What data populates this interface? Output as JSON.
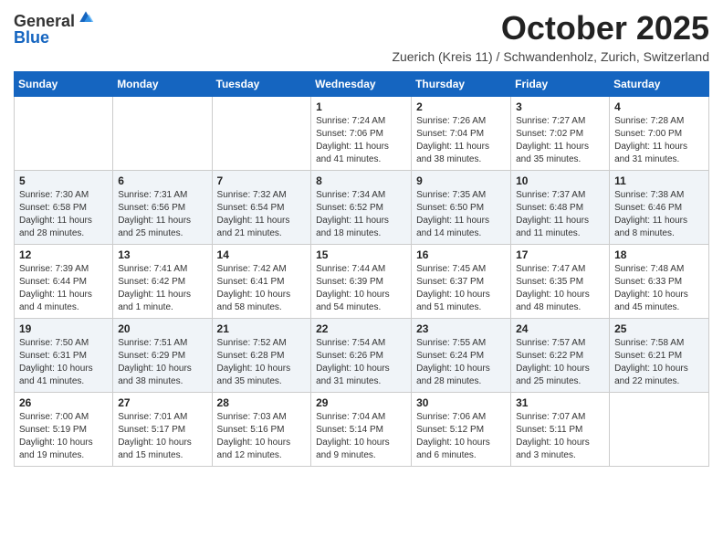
{
  "logo": {
    "general": "General",
    "blue": "Blue"
  },
  "title": "October 2025",
  "subtitle": "Zuerich (Kreis 11) / Schwandenholz, Zurich, Switzerland",
  "days_of_week": [
    "Sunday",
    "Monday",
    "Tuesday",
    "Wednesday",
    "Thursday",
    "Friday",
    "Saturday"
  ],
  "weeks": [
    [
      {
        "day": "",
        "info": ""
      },
      {
        "day": "",
        "info": ""
      },
      {
        "day": "",
        "info": ""
      },
      {
        "day": "1",
        "info": "Sunrise: 7:24 AM\nSunset: 7:06 PM\nDaylight: 11 hours and 41 minutes."
      },
      {
        "day": "2",
        "info": "Sunrise: 7:26 AM\nSunset: 7:04 PM\nDaylight: 11 hours and 38 minutes."
      },
      {
        "day": "3",
        "info": "Sunrise: 7:27 AM\nSunset: 7:02 PM\nDaylight: 11 hours and 35 minutes."
      },
      {
        "day": "4",
        "info": "Sunrise: 7:28 AM\nSunset: 7:00 PM\nDaylight: 11 hours and 31 minutes."
      }
    ],
    [
      {
        "day": "5",
        "info": "Sunrise: 7:30 AM\nSunset: 6:58 PM\nDaylight: 11 hours and 28 minutes."
      },
      {
        "day": "6",
        "info": "Sunrise: 7:31 AM\nSunset: 6:56 PM\nDaylight: 11 hours and 25 minutes."
      },
      {
        "day": "7",
        "info": "Sunrise: 7:32 AM\nSunset: 6:54 PM\nDaylight: 11 hours and 21 minutes."
      },
      {
        "day": "8",
        "info": "Sunrise: 7:34 AM\nSunset: 6:52 PM\nDaylight: 11 hours and 18 minutes."
      },
      {
        "day": "9",
        "info": "Sunrise: 7:35 AM\nSunset: 6:50 PM\nDaylight: 11 hours and 14 minutes."
      },
      {
        "day": "10",
        "info": "Sunrise: 7:37 AM\nSunset: 6:48 PM\nDaylight: 11 hours and 11 minutes."
      },
      {
        "day": "11",
        "info": "Sunrise: 7:38 AM\nSunset: 6:46 PM\nDaylight: 11 hours and 8 minutes."
      }
    ],
    [
      {
        "day": "12",
        "info": "Sunrise: 7:39 AM\nSunset: 6:44 PM\nDaylight: 11 hours and 4 minutes."
      },
      {
        "day": "13",
        "info": "Sunrise: 7:41 AM\nSunset: 6:42 PM\nDaylight: 11 hours and 1 minute."
      },
      {
        "day": "14",
        "info": "Sunrise: 7:42 AM\nSunset: 6:41 PM\nDaylight: 10 hours and 58 minutes."
      },
      {
        "day": "15",
        "info": "Sunrise: 7:44 AM\nSunset: 6:39 PM\nDaylight: 10 hours and 54 minutes."
      },
      {
        "day": "16",
        "info": "Sunrise: 7:45 AM\nSunset: 6:37 PM\nDaylight: 10 hours and 51 minutes."
      },
      {
        "day": "17",
        "info": "Sunrise: 7:47 AM\nSunset: 6:35 PM\nDaylight: 10 hours and 48 minutes."
      },
      {
        "day": "18",
        "info": "Sunrise: 7:48 AM\nSunset: 6:33 PM\nDaylight: 10 hours and 45 minutes."
      }
    ],
    [
      {
        "day": "19",
        "info": "Sunrise: 7:50 AM\nSunset: 6:31 PM\nDaylight: 10 hours and 41 minutes."
      },
      {
        "day": "20",
        "info": "Sunrise: 7:51 AM\nSunset: 6:29 PM\nDaylight: 10 hours and 38 minutes."
      },
      {
        "day": "21",
        "info": "Sunrise: 7:52 AM\nSunset: 6:28 PM\nDaylight: 10 hours and 35 minutes."
      },
      {
        "day": "22",
        "info": "Sunrise: 7:54 AM\nSunset: 6:26 PM\nDaylight: 10 hours and 31 minutes."
      },
      {
        "day": "23",
        "info": "Sunrise: 7:55 AM\nSunset: 6:24 PM\nDaylight: 10 hours and 28 minutes."
      },
      {
        "day": "24",
        "info": "Sunrise: 7:57 AM\nSunset: 6:22 PM\nDaylight: 10 hours and 25 minutes."
      },
      {
        "day": "25",
        "info": "Sunrise: 7:58 AM\nSunset: 6:21 PM\nDaylight: 10 hours and 22 minutes."
      }
    ],
    [
      {
        "day": "26",
        "info": "Sunrise: 7:00 AM\nSunset: 5:19 PM\nDaylight: 10 hours and 19 minutes."
      },
      {
        "day": "27",
        "info": "Sunrise: 7:01 AM\nSunset: 5:17 PM\nDaylight: 10 hours and 15 minutes."
      },
      {
        "day": "28",
        "info": "Sunrise: 7:03 AM\nSunset: 5:16 PM\nDaylight: 10 hours and 12 minutes."
      },
      {
        "day": "29",
        "info": "Sunrise: 7:04 AM\nSunset: 5:14 PM\nDaylight: 10 hours and 9 minutes."
      },
      {
        "day": "30",
        "info": "Sunrise: 7:06 AM\nSunset: 5:12 PM\nDaylight: 10 hours and 6 minutes."
      },
      {
        "day": "31",
        "info": "Sunrise: 7:07 AM\nSunset: 5:11 PM\nDaylight: 10 hours and 3 minutes."
      },
      {
        "day": "",
        "info": ""
      }
    ]
  ]
}
